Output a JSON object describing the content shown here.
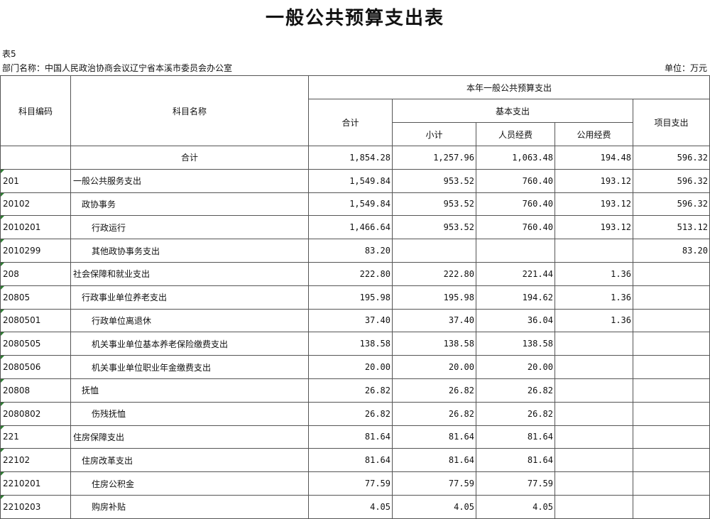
{
  "title": "一般公共预算支出表",
  "table_no": "表5",
  "department": "部门名称：中国人民政治协商会议辽宁省本溪市委员会办公室",
  "unit": "单位：万元",
  "headers": {
    "code": "科目编码",
    "name": "科目名称",
    "group": "本年一般公共预算支出",
    "total": "合计",
    "basic": "基本支出",
    "subtotal": "小计",
    "personnel": "人员经费",
    "public": "公用经费",
    "project": "项目支出"
  },
  "rows": [
    {
      "code": "",
      "name": "合计",
      "level": "total",
      "total": "1,854.28",
      "subtotal": "1,257.96",
      "personnel": "1,063.48",
      "public": "194.48",
      "project": "596.32"
    },
    {
      "code": "201",
      "name": "一般公共服务支出",
      "level": 0,
      "total": "1,549.84",
      "subtotal": "953.52",
      "personnel": "760.40",
      "public": "193.12",
      "project": "596.32"
    },
    {
      "code": "20102",
      "name": "政协事务",
      "level": 1,
      "total": "1,549.84",
      "subtotal": "953.52",
      "personnel": "760.40",
      "public": "193.12",
      "project": "596.32"
    },
    {
      "code": "2010201",
      "name": "行政运行",
      "level": 2,
      "total": "1,466.64",
      "subtotal": "953.52",
      "personnel": "760.40",
      "public": "193.12",
      "project": "513.12"
    },
    {
      "code": "2010299",
      "name": "其他政协事务支出",
      "level": 2,
      "total": "83.20",
      "subtotal": "",
      "personnel": "",
      "public": "",
      "project": "83.20"
    },
    {
      "code": "208",
      "name": "社会保障和就业支出",
      "level": 0,
      "total": "222.80",
      "subtotal": "222.80",
      "personnel": "221.44",
      "public": "1.36",
      "project": ""
    },
    {
      "code": "20805",
      "name": "行政事业单位养老支出",
      "level": 1,
      "total": "195.98",
      "subtotal": "195.98",
      "personnel": "194.62",
      "public": "1.36",
      "project": ""
    },
    {
      "code": "2080501",
      "name": "行政单位离退休",
      "level": 2,
      "total": "37.40",
      "subtotal": "37.40",
      "personnel": "36.04",
      "public": "1.36",
      "project": ""
    },
    {
      "code": "2080505",
      "name": "机关事业单位基本养老保险缴费支出",
      "level": 2,
      "total": "138.58",
      "subtotal": "138.58",
      "personnel": "138.58",
      "public": "",
      "project": ""
    },
    {
      "code": "2080506",
      "name": "机关事业单位职业年金缴费支出",
      "level": 2,
      "total": "20.00",
      "subtotal": "20.00",
      "personnel": "20.00",
      "public": "",
      "project": ""
    },
    {
      "code": "20808",
      "name": "抚恤",
      "level": 1,
      "total": "26.82",
      "subtotal": "26.82",
      "personnel": "26.82",
      "public": "",
      "project": ""
    },
    {
      "code": "2080802",
      "name": "伤残抚恤",
      "level": 2,
      "total": "26.82",
      "subtotal": "26.82",
      "personnel": "26.82",
      "public": "",
      "project": ""
    },
    {
      "code": "221",
      "name": "住房保障支出",
      "level": 0,
      "total": "81.64",
      "subtotal": "81.64",
      "personnel": "81.64",
      "public": "",
      "project": ""
    },
    {
      "code": "22102",
      "name": "住房改革支出",
      "level": 1,
      "total": "81.64",
      "subtotal": "81.64",
      "personnel": "81.64",
      "public": "",
      "project": ""
    },
    {
      "code": "2210201",
      "name": "住房公积金",
      "level": 2,
      "total": "77.59",
      "subtotal": "77.59",
      "personnel": "77.59",
      "public": "",
      "project": ""
    },
    {
      "code": "2210203",
      "name": "购房补贴",
      "level": 2,
      "total": "4.05",
      "subtotal": "4.05",
      "personnel": "4.05",
      "public": "",
      "project": ""
    }
  ]
}
